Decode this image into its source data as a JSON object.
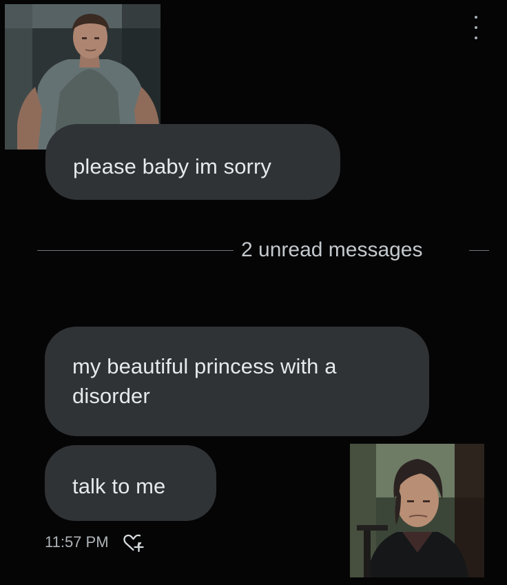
{
  "conversation": {
    "menu_icon": "more-vertical-icon",
    "messages": [
      {
        "text": "please baby im sorry"
      },
      {
        "text": "my beautiful princess with a disorder"
      },
      {
        "text": "talk to me"
      }
    ],
    "unread_divider": {
      "text": "2 unread messages"
    },
    "last_message_meta": {
      "time": "11:57 PM",
      "reaction_icon": "heart-add-icon"
    }
  },
  "colors": {
    "background": "#050505",
    "bubble": "#2f3336",
    "text": "#e7e9ea",
    "muted_text": "#aeb4b8",
    "divider": "#71767b"
  }
}
